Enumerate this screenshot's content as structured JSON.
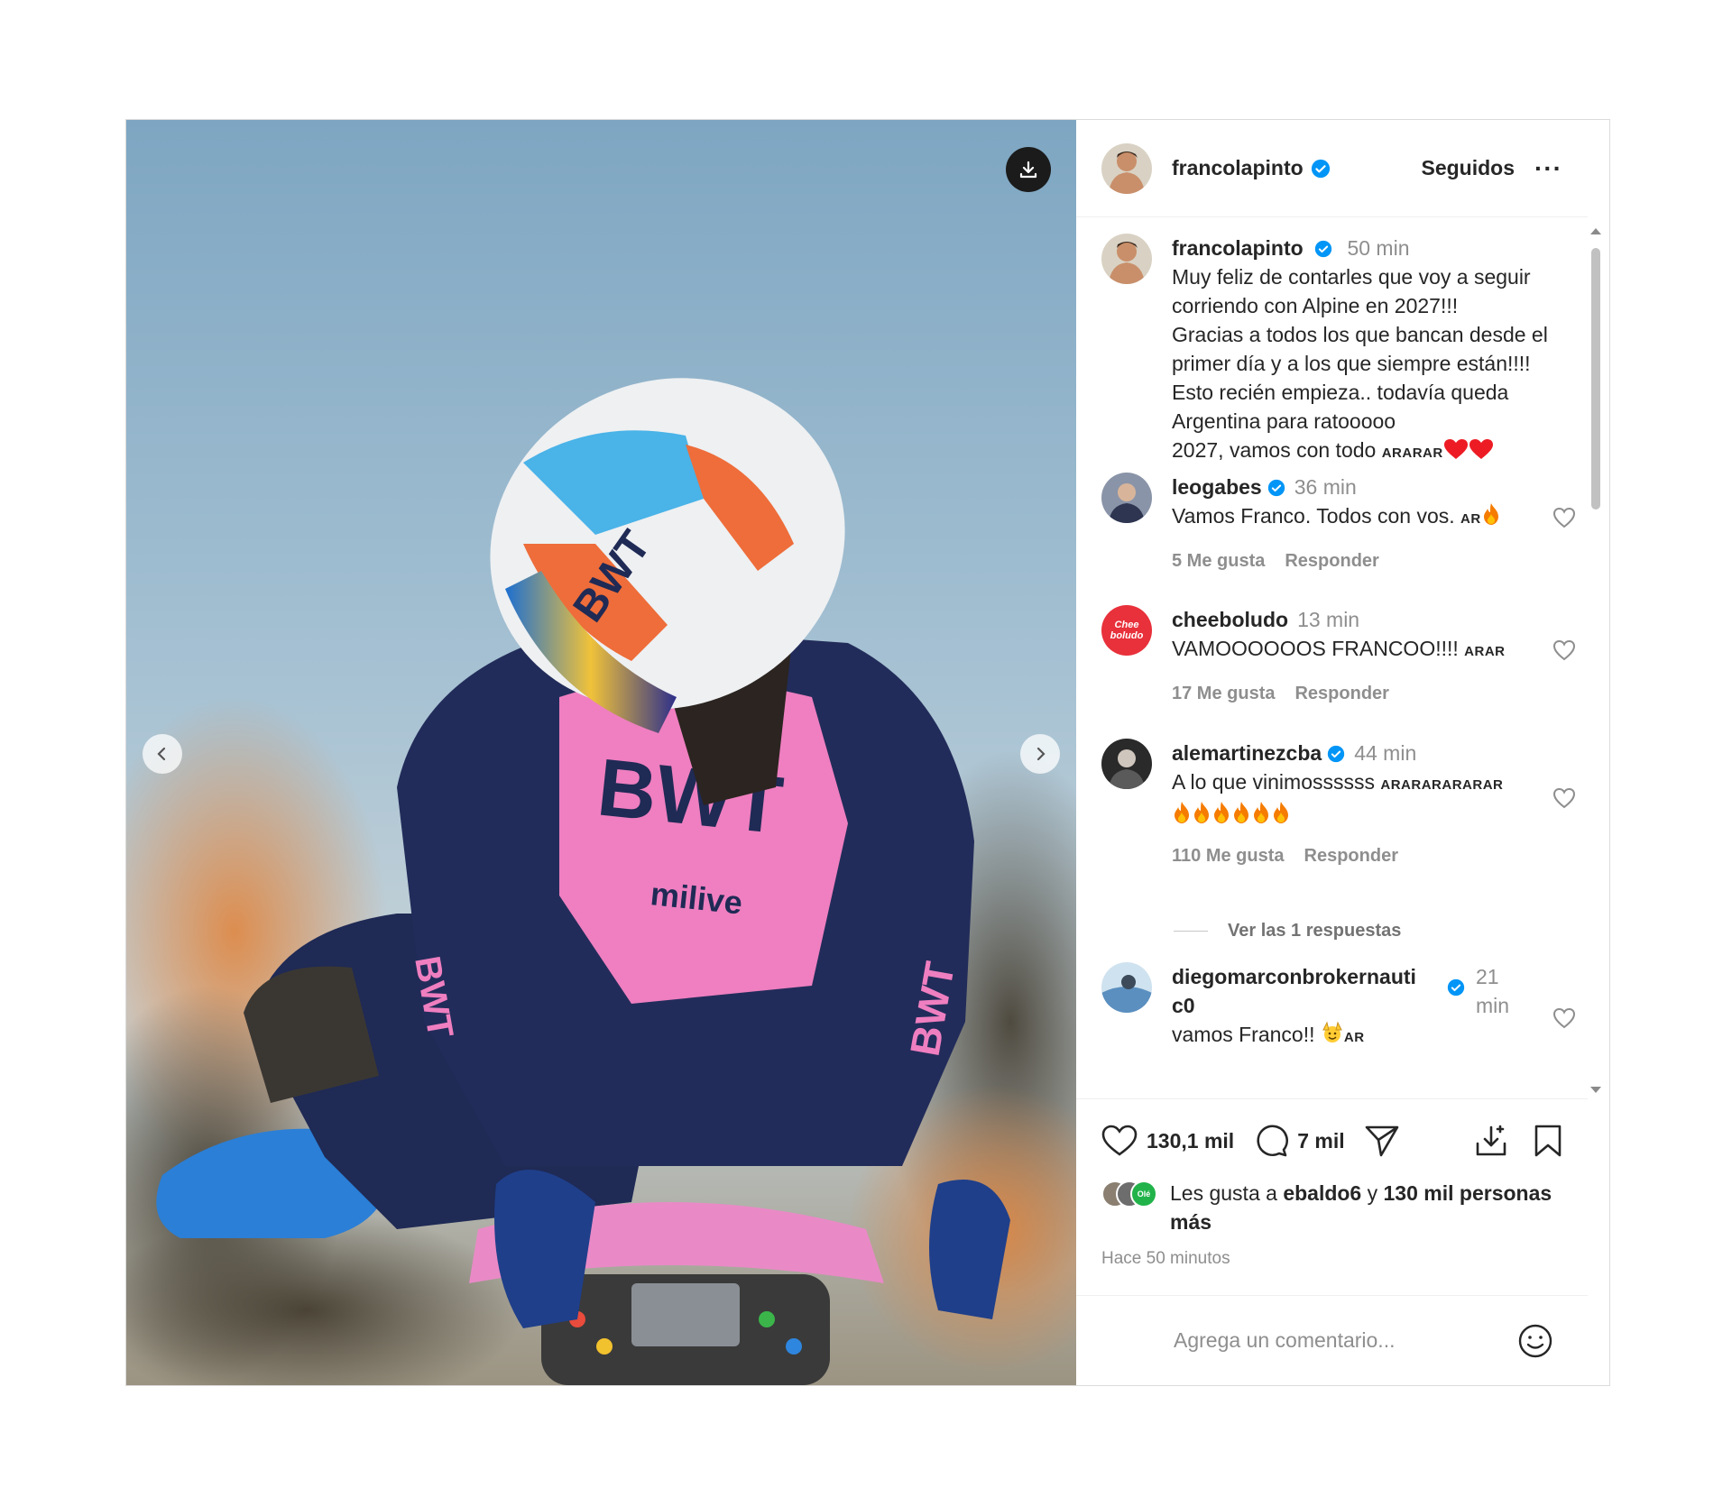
{
  "post": {
    "author": "francolapinto",
    "follow_state": "Seguidos",
    "more": "···"
  },
  "caption": {
    "username": "francolapinto",
    "time": "50 min",
    "lines": [
      "Muy feliz de contarles que voy a seguir",
      "corriendo con Alpine en 2027!!!",
      "",
      "Gracias a todos los que bancan desde el",
      "primer día y a los que siempre están!!!!",
      "Esto recién empieza.. todavía queda",
      "Argentina para ratooooo"
    ],
    "last_line": "2027, vamos con todo",
    "last_flags": "ARARAR"
  },
  "comments": [
    {
      "username": "leogabes",
      "time": "36 min",
      "text": "Vamos Franco. Todos con vos.",
      "flags": "AR",
      "likes": "5 Me gusta",
      "reply": "Responder"
    },
    {
      "username": "cheeboludo",
      "avatar_text": "Chee boludo",
      "time": "13 min",
      "text": "VAMOOOOOOS FRANCOO!!!!",
      "flags": "ARAR",
      "likes": "17 Me gusta",
      "reply": "Responder"
    },
    {
      "username": "alemartinezcba",
      "time": "44 min",
      "text": "A lo que vinimossssss",
      "flags": "ARARARARARAR",
      "likes": "110 Me gusta",
      "reply": "Responder",
      "view_replies": "Ver las 1 respuestas"
    },
    {
      "username_line1": "diegomarconbrokernauti",
      "username_line2": "c0",
      "time_line1": "21",
      "time_line2": "min",
      "text": "vamos Franco!!",
      "flags": "AR"
    }
  ],
  "footer": {
    "likes_count": "130,1 mil",
    "comments_count": "7 mil",
    "likes_prefix": "Les gusta a",
    "liked_by": "ebaldo6",
    "likes_joiner": "y",
    "likes_others": "130 mil personas",
    "likes_more": "más",
    "posted_ago": "Hace 50 minutos",
    "mini_avatar_text": "Olé"
  },
  "composer": {
    "placeholder": "Agrega un comentario..."
  },
  "colors": {
    "verified_blue": "#0095f6",
    "heart_red": "#ed1c24",
    "fire_orange": "#f57c00",
    "chee_red": "#e8313b"
  }
}
